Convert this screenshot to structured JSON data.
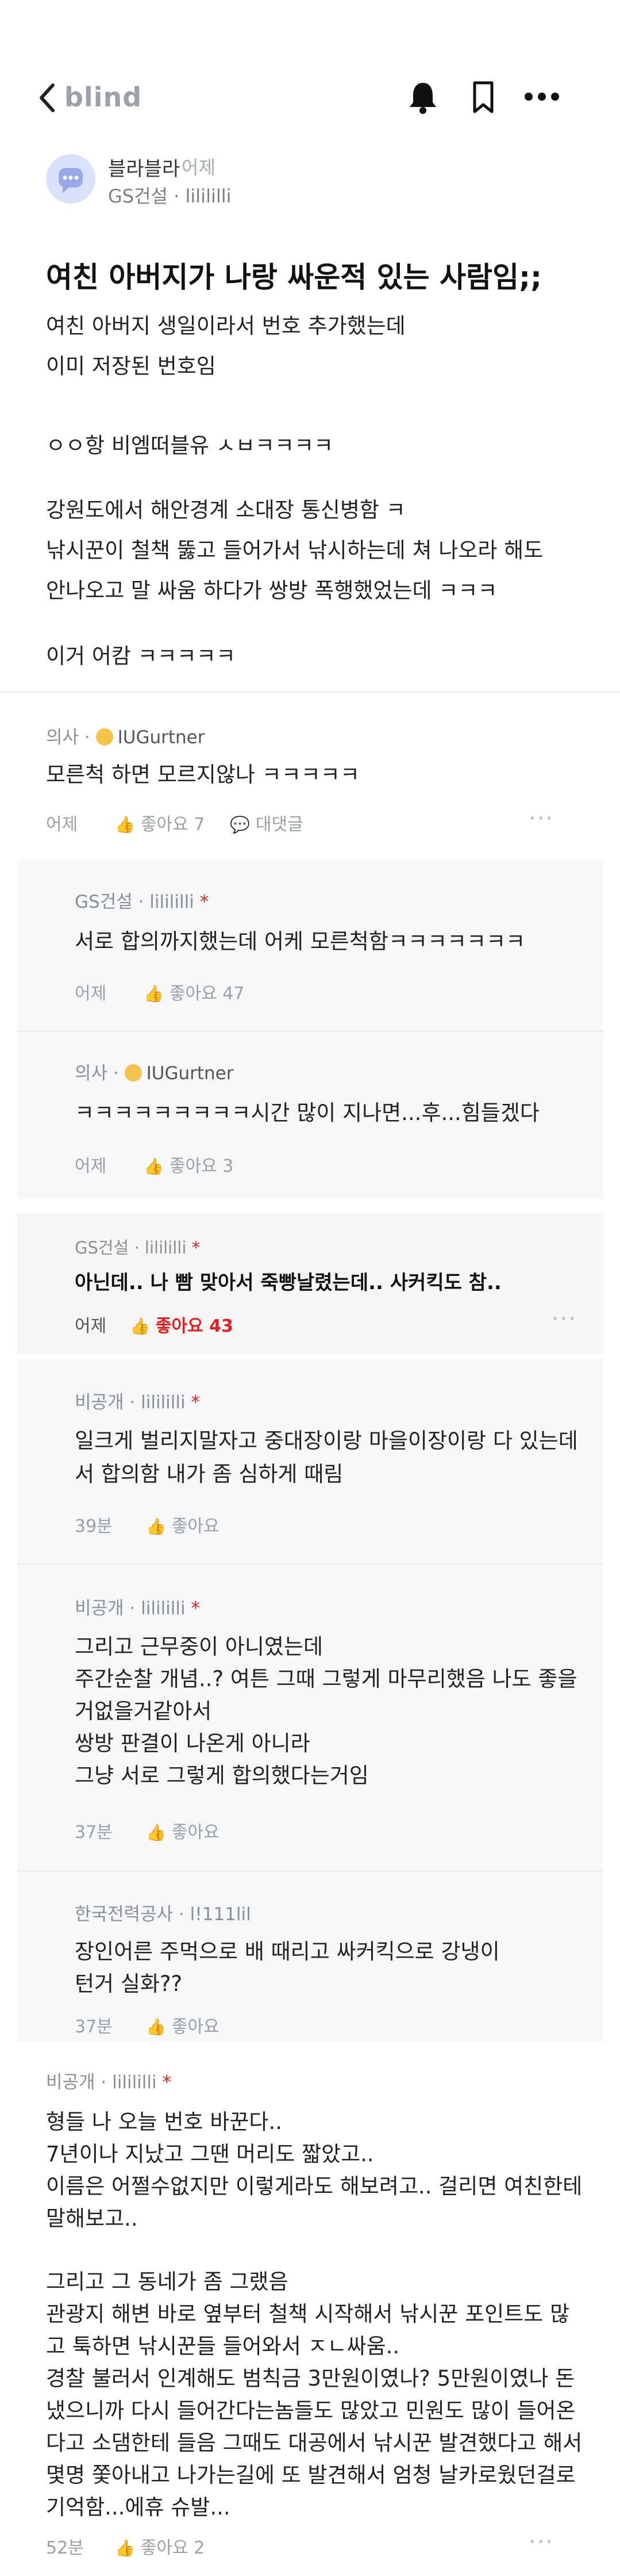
{
  "header": {
    "brand": "blind"
  },
  "post": {
    "author": "블라블라",
    "time": "어제",
    "company": "GS건설 · lilililli",
    "title": "여친 아버지가 나랑 싸운적 있는 사람임;;",
    "lines": [
      "여친 아버지 생일이라서 번호 추가했는데",
      "이미 저장된 번호임",
      "",
      "ㅇㅇ항 비엠떠블유 ㅅㅂㅋㅋㅋㅋ",
      "",
      "강원도에서 해안경계 소대장 통신병함 ㅋ",
      "낚시꾼이 철책 뚫고 들어가서 낚시하는데 쳐 나오라 해도",
      "안나오고 말 싸움 하다가 쌍방 폭행했었는데 ㅋㅋㅋ",
      "",
      "이거 어캄 ㅋㅋㅋㅋㅋ"
    ]
  },
  "comments": {
    "c1": {
      "meta_job": "의사 · ",
      "meta_user": "IUGurtner",
      "text": "모른척 하면 모르지않나 ㅋㅋㅋㅋㅋ",
      "time": "어제",
      "likes": "좋아요 7",
      "reply_label": "대댓글"
    },
    "r1": {
      "meta": "GS건설 · lilililli",
      "mark": "*",
      "text": "서로 합의까지했는데 어케 모른척함ㅋㅋㅋㅋㅋㅋㅋ",
      "time": "어제",
      "likes": "좋아요 47"
    },
    "r2": {
      "meta_job": "의사 · ",
      "meta_user": "IUGurtner",
      "text": "ㅋㅋㅋㅋㅋㅋㅋㅋㅋ시간 많이 지나면...후...힘들겠다",
      "time": "어제",
      "likes": "좋아요 3"
    },
    "r3": {
      "meta": "GS건설 · lilililli",
      "mark": "*",
      "text": "아닌데.. 나 빰 맞아서 죽빵날렸는데.. 사커킥도 참..",
      "time": "어제",
      "likes": "좋아요 43"
    },
    "r4": {
      "meta": "비공개 · lilililli",
      "mark": "*",
      "lines": [
        "일크게 벌리지말자고 중대장이랑 마을이장이랑 다 있는데",
        "서 합의함 내가 좀 심하게 때림"
      ],
      "time": "39분",
      "likes": "좋아요"
    },
    "r5": {
      "meta": "비공개 · lilililli",
      "mark": "*",
      "lines": [
        "그리고 근무중이 아니였는데",
        "주간순찰 개념..? 여튼 그때 그렇게 마무리했음 나도 좋을",
        "거없을거같아서",
        "쌍방 판결이 나온게 아니라",
        "그냥 서로 그렇게 합의했다는거임"
      ],
      "time": "37분",
      "likes": "좋아요"
    },
    "r6": {
      "meta": "한국전력공사 · l!111lil",
      "lines": [
        "장인어른 주먹으로 배 때리고 싸커킥으로 강냉이",
        "턴거 실화??"
      ],
      "time": "37분",
      "likes": "좋아요"
    },
    "c2": {
      "meta": "비공개 · lilililli",
      "mark": "*",
      "lines": [
        "형들 나 오늘 번호 바꾼다..",
        "7년이나 지났고 그땐 머리도 짧았고..",
        "이름은 어쩔수없지만 이렇게라도 해보려고.. 걸리면 여친한테",
        "말해보고..",
        "",
        "그리고 그 동네가 좀 그랬음",
        "관광지 해변 바로 옆부터 철책 시작해서 낚시꾼 포인트도 많",
        "고 툭하면 낚시꾼들 들어와서 ㅈㄴ싸움..",
        "경찰 불러서 인계해도 범칙금 3만원이였나? 5만원이였나 돈",
        "냈으니까 다시 들어간다는놈들도 많았고 민원도 많이 들어온",
        "다고 소댐한테 들음 그때도 대공에서 낚시꾼 발견했다고 해서",
        "몇명 쫓아내고 나가는길에 또 발견해서 엄청 날카로웠던걸로",
        "기억함...에휴 슈발..."
      ],
      "time": "52분",
      "likes": "좋아요 2"
    }
  }
}
